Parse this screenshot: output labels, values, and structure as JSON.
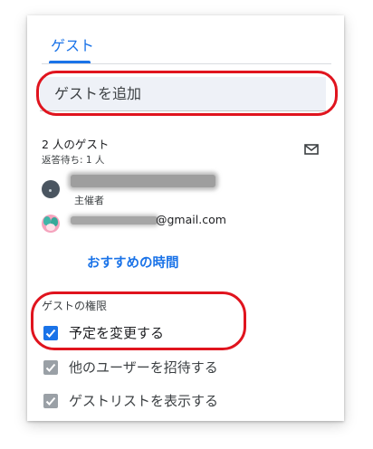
{
  "tabs": {
    "guests": "ゲスト"
  },
  "add_guest": {
    "placeholder": "ゲストを追加"
  },
  "guests": {
    "count_label": "2 人のゲスト",
    "pending_label": "返答待ち: 1 人",
    "host_role": "主催者",
    "guest2_email_suffix": "@gmail.com"
  },
  "suggested_times": "おすすめの時間",
  "permissions": {
    "heading": "ゲストの権限",
    "items": [
      {
        "label": "予定を変更する",
        "checked": true,
        "enabled": true
      },
      {
        "label": "他のユーザーを招待する",
        "checked": true,
        "enabled": false
      },
      {
        "label": "ゲストリストを表示する",
        "checked": true,
        "enabled": false
      }
    ]
  },
  "icons": {
    "email": "mail-icon",
    "checkbox": "checkmark-icon"
  },
  "colors": {
    "accent": "#1a73e8",
    "annotation_red": "#e0141e",
    "disabled_checkbox": "#9aa0a6"
  }
}
